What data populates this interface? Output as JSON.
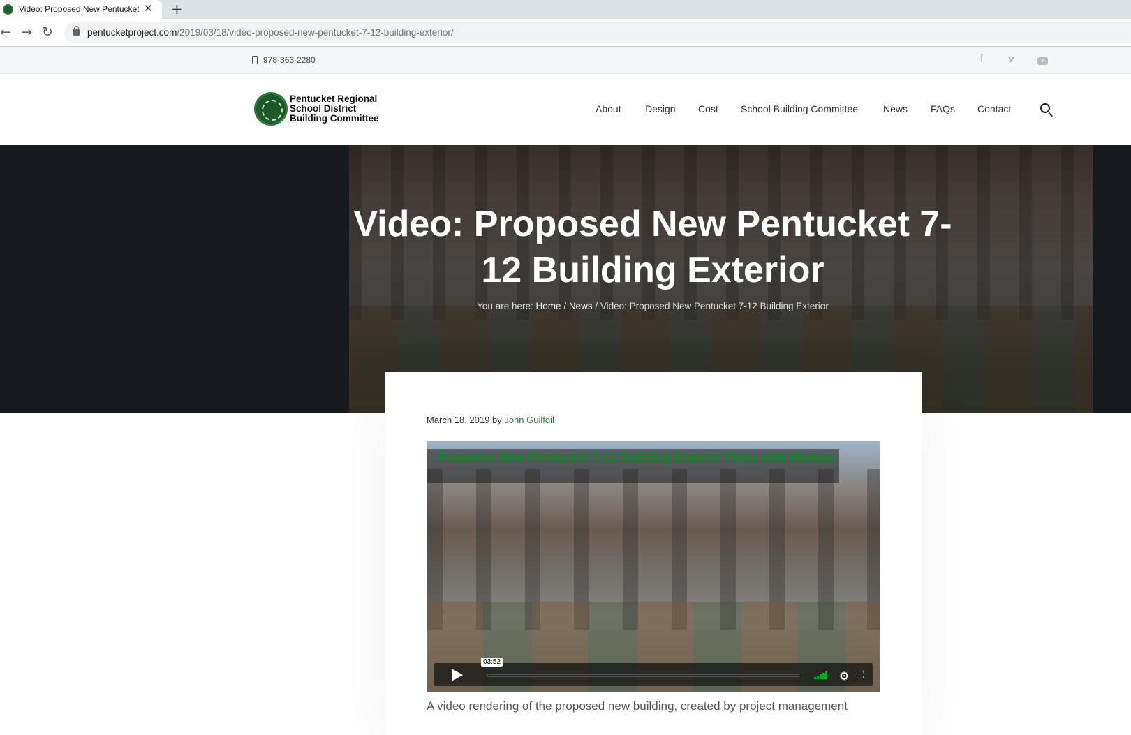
{
  "browser": {
    "tab_title": "Video: Proposed New Pentucket",
    "tab_close": "✕",
    "new_tab": "+",
    "back": "←",
    "forward": "→",
    "reload": "↻",
    "url_host": "pentucketproject.com",
    "url_path": "/2019/03/18/video-proposed-new-pentucket-7-12-building-exterior/"
  },
  "topbar": {
    "phone": "978-363-2280",
    "social": {
      "facebook": "f",
      "vimeo": "v",
      "youtube": "youtube-icon"
    }
  },
  "header": {
    "logo_lines": [
      "Pentucket Regional",
      "School District",
      "Building Committee"
    ],
    "nav": [
      "About",
      "Design",
      "Cost",
      "School Building Committee",
      "News",
      "FAQs",
      "Contact"
    ]
  },
  "hero": {
    "title": "Video: Proposed New Pentucket 7-12 Building Exterior",
    "breadcrumb": {
      "prefix": "You are here:",
      "home": "Home",
      "news": "News",
      "sep": "/",
      "current": "Video: Proposed New Pentucket 7-12 Building Exterior"
    }
  },
  "post": {
    "date": "March 18, 2019",
    "by": "by",
    "author": "John Guilfoil",
    "video": {
      "title": "Proposed New Pentucket 7-12 Building Exterior Flyby with Markup",
      "duration": "03:52",
      "icons": [
        "play-icon",
        "volume-icon",
        "settings-icon",
        "fullscreen-icon"
      ]
    },
    "intro": "A video rendering of the proposed new building, created by project management"
  },
  "colors": {
    "accent_green": "#2e7a3c",
    "video_title_green": "#0a8a1f",
    "hero_dark": "#16191d"
  }
}
